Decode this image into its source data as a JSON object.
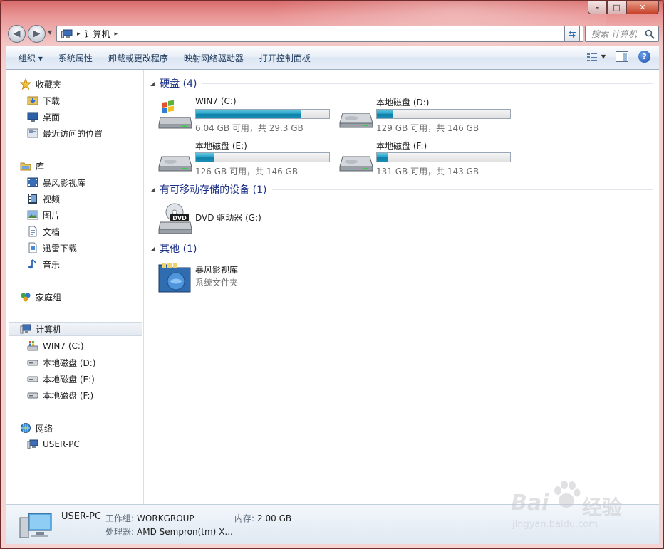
{
  "window": {
    "caption_buttons": {
      "minimize": "–",
      "maximize": "□",
      "close": "✕"
    }
  },
  "nav": {
    "back_glyph": "◀",
    "forward_glyph": "▶",
    "address": {
      "segments": [
        "计算机"
      ],
      "separator": "▸"
    },
    "search_placeholder": "搜索 计算机"
  },
  "toolbar": {
    "organize": "组织 ▾",
    "system_properties": "系统属性",
    "uninstall": "卸载或更改程序",
    "map_drive": "映射网络驱动器",
    "control_panel": "打开控制面板",
    "help": "?"
  },
  "nav_pane": {
    "favorites": {
      "label": "收藏夹",
      "items": [
        "下载",
        "桌面",
        "最近访问的位置"
      ]
    },
    "libraries": {
      "label": "库",
      "items": [
        "暴风影视库",
        "视频",
        "图片",
        "文档",
        "迅雷下载",
        "音乐"
      ]
    },
    "homegroup": {
      "label": "家庭组"
    },
    "computer": {
      "label": "计算机",
      "items": [
        "WIN7 (C:)",
        "本地磁盘 (D:)",
        "本地磁盘 (E:)",
        "本地磁盘 (F:)"
      ]
    },
    "network": {
      "label": "网络",
      "items": [
        "USER-PC"
      ]
    }
  },
  "groups": {
    "hard_disks": {
      "title": "硬盘 (4)",
      "drives": [
        {
          "name": "WIN7 (C:)",
          "info": "6.04 GB 可用，共 29.3 GB",
          "used_fraction": 0.794
        },
        {
          "name": "本地磁盘 (D:)",
          "info": "129 GB 可用，共 146 GB",
          "used_fraction": 0.116
        },
        {
          "name": "本地磁盘 (E:)",
          "info": "126 GB 可用，共 146 GB",
          "used_fraction": 0.137
        },
        {
          "name": "本地磁盘 (F:)",
          "info": "131 GB 可用，共 143 GB",
          "used_fraction": 0.084
        }
      ]
    },
    "removable": {
      "title": "有可移动存储的设备 (1)",
      "items": [
        {
          "name": "DVD 驱动器 (G:)"
        }
      ]
    },
    "other": {
      "title": "其他 (1)",
      "items": [
        {
          "name": "暴风影视库",
          "subtitle": "系统文件夹"
        }
      ]
    }
  },
  "details": {
    "computer_name": "USER-PC",
    "workgroup_label": "工作组:",
    "workgroup_value": "WORKGROUP",
    "memory_label": "内存:",
    "memory_value": "2.00 GB",
    "processor_label": "处理器:",
    "processor_value": "AMD Sempron(tm) X..."
  },
  "watermark": {
    "brand": "Bai",
    "brand_cn": "经验",
    "url": "jingyan.baidu.com"
  }
}
